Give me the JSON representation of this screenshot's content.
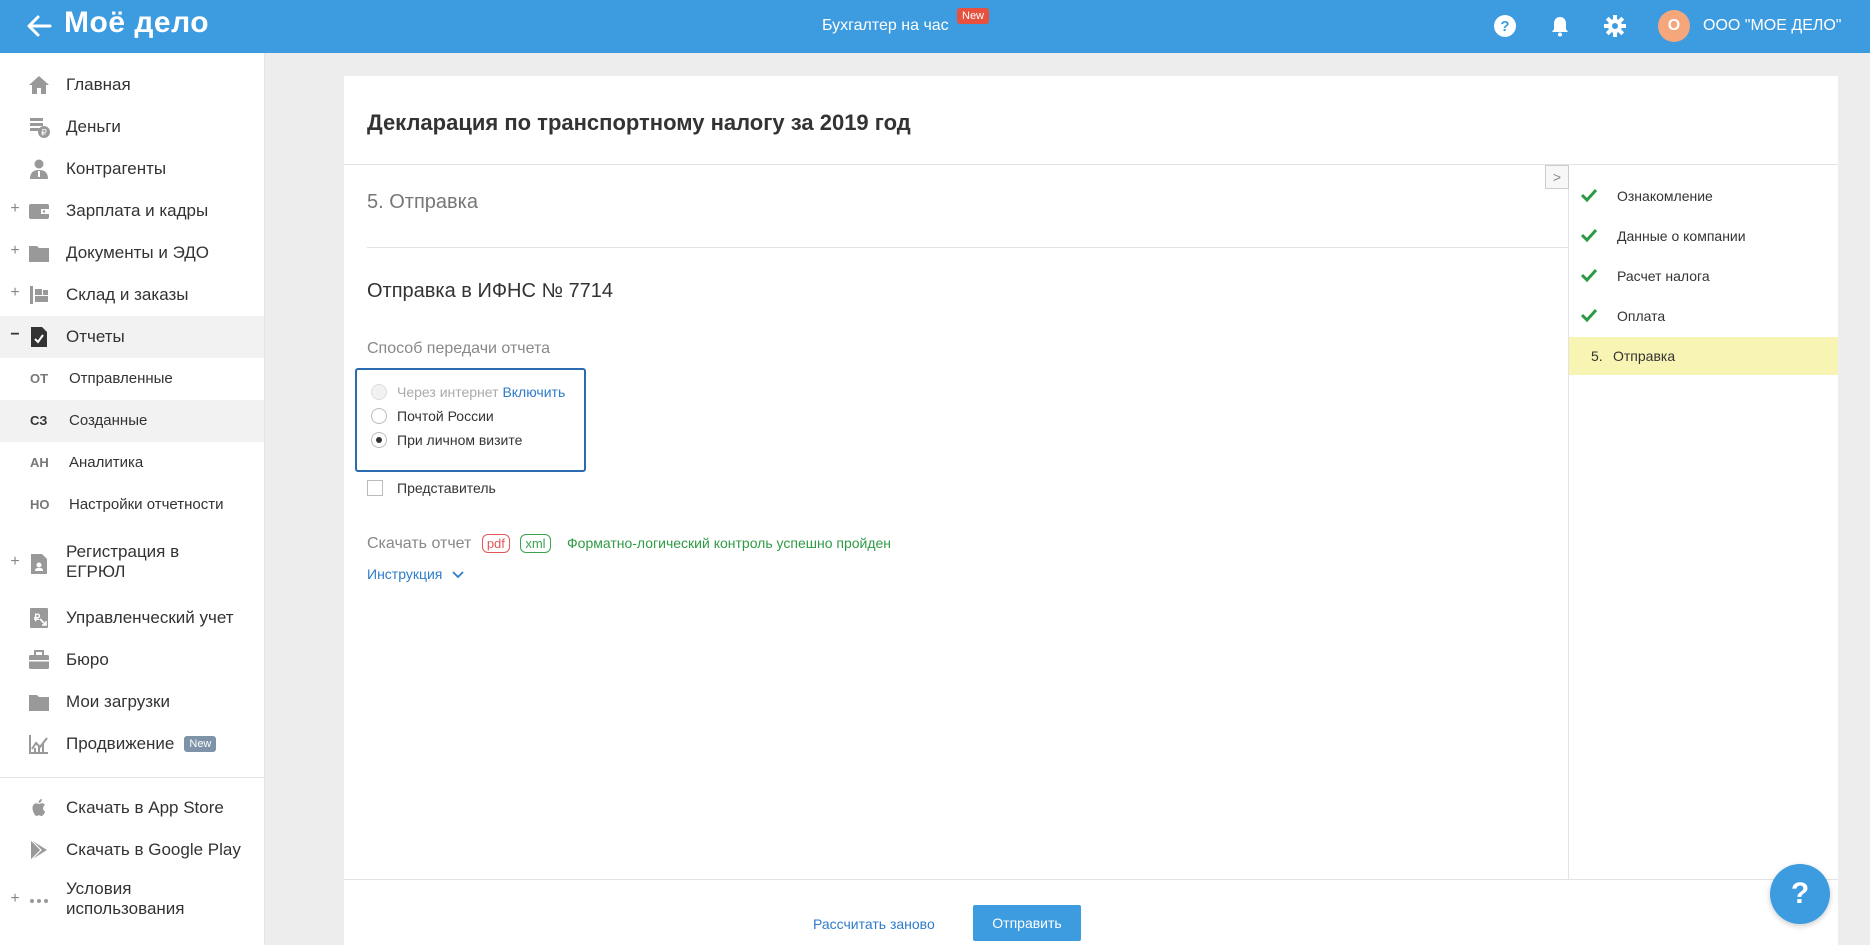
{
  "header": {
    "logo": "Моё дело",
    "center_link": "Бухгалтер на час",
    "center_badge": "New",
    "avatar_letter": "О",
    "company": "ООО \"МОЕ ДЕЛО\""
  },
  "sidebar": {
    "items": [
      {
        "label": "Главная",
        "icon": "home-icon"
      },
      {
        "label": "Деньги",
        "icon": "money-icon"
      },
      {
        "label": "Контрагенты",
        "icon": "contractors-icon"
      },
      {
        "label": "Зарплата и кадры",
        "icon": "wallet-icon",
        "plus": "+"
      },
      {
        "label": "Документы и ЭДО",
        "icon": "folder-icon",
        "plus": "+"
      },
      {
        "label": "Склад и заказы",
        "icon": "warehouse-icon",
        "plus": "+"
      },
      {
        "label": "Отчеты",
        "icon": "report-icon",
        "plus": "−"
      }
    ],
    "sub_items": [
      {
        "abbr": "ОТ",
        "label": "Отправленные"
      },
      {
        "abbr": "СЗ",
        "label": "Созданные"
      },
      {
        "abbr": "АН",
        "label": "Аналитика"
      },
      {
        "abbr": "НО",
        "label": "Настройки отчетности"
      }
    ],
    "items2": [
      {
        "label_line1": "Регистрация в",
        "label_line2": "ЕГРЮЛ",
        "icon": "registration-icon",
        "plus": "+"
      },
      {
        "label": "Управленческий учет",
        "icon": "management-icon"
      },
      {
        "label": "Бюро",
        "icon": "briefcase-icon"
      },
      {
        "label": "Мои загрузки",
        "icon": "folder-icon"
      },
      {
        "label": "Продвижение",
        "icon": "chart-icon",
        "badge": "New"
      }
    ],
    "bottom": [
      {
        "label": "Скачать в App Store",
        "icon": "apple-icon"
      },
      {
        "label": "Скачать в Google Play",
        "icon": "google-play-icon"
      },
      {
        "label_line1": "Условия",
        "label_line2": "использования",
        "icon": "more-icon",
        "plus": "+"
      }
    ]
  },
  "main": {
    "title": "Декларация по транспортному налогу за 2019 год",
    "step_heading": "5. Отправка",
    "sub_heading": "Отправка в ИФНС № 7714",
    "method_label": "Способ передачи отчета",
    "options": [
      {
        "label": "Через интернет",
        "link": "Включить",
        "state": "disabled"
      },
      {
        "label": "Почтой России",
        "state": "unchecked"
      },
      {
        "label": "При личном визите",
        "state": "checked"
      }
    ],
    "representative": "Представитель",
    "download_label": "Скачать отчет",
    "pdf": "pdf",
    "xml": "xml",
    "flk_status": "Форматно-логический контроль успешно пройден",
    "instruction": "Инструкция",
    "collapse": ">"
  },
  "steps": [
    {
      "label": "Ознакомление",
      "done": true
    },
    {
      "label": "Данные о компании",
      "done": true
    },
    {
      "label": "Расчет налога",
      "done": true
    },
    {
      "label": "Оплата",
      "done": true
    },
    {
      "num": "5.",
      "label": "Отправка",
      "current": true
    }
  ],
  "footer": {
    "recalc": "Рассчитать заново",
    "send": "Отправить"
  },
  "help": "?",
  "colors": {
    "primary": "#3d9be0",
    "success": "#2f9a45",
    "error": "#e25858",
    "highlight": "#f8f4b4"
  }
}
